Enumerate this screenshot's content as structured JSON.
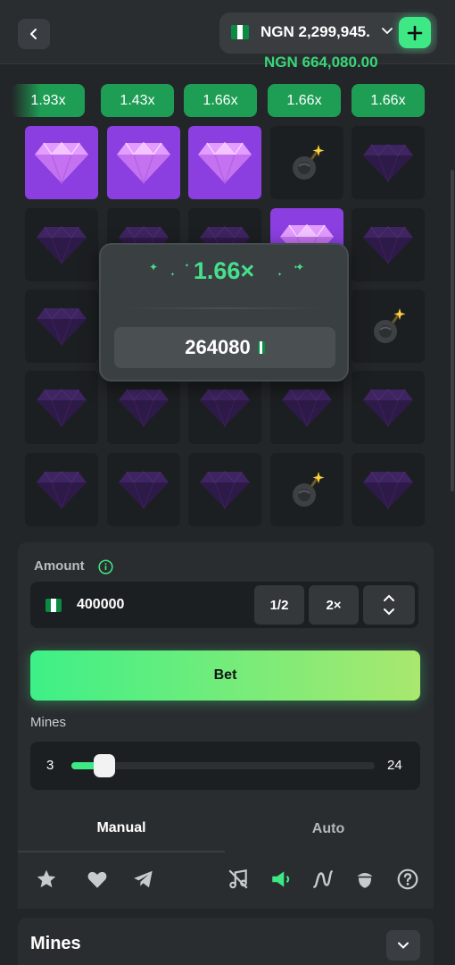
{
  "header": {
    "balance": "NGN 2,299,945.",
    "win_amount": "NGN 664,080.00"
  },
  "multipliers": [
    "1.93x",
    "1.43x",
    "1.66x",
    "1.66x",
    "1.66x"
  ],
  "grid": {
    "tiles": [
      [
        "gem-revealed",
        "gem-revealed",
        "gem-revealed",
        "bomb",
        "gem"
      ],
      [
        "gem",
        "gem",
        "gem",
        "gem-revealed",
        "gem"
      ],
      [
        "gem",
        "gem",
        "gem",
        "gem",
        "bomb"
      ],
      [
        "gem",
        "gem",
        "gem",
        "gem",
        "gem"
      ],
      [
        "gem",
        "gem",
        "gem",
        "bomb",
        "gem"
      ]
    ]
  },
  "result_popup": {
    "multiplier": "1.66×",
    "amount": "264080"
  },
  "controls": {
    "amount_label": "Amount",
    "amount_value": "400000",
    "half_label": "1/2",
    "double_label": "2×",
    "bet_label": "Bet",
    "mines_label": "Mines",
    "mines_min": "3",
    "mines_max": "24",
    "mines_level": 0.09
  },
  "tabs": [
    {
      "label": "Manual",
      "active": true
    },
    {
      "label": "Auto",
      "active": false
    }
  ],
  "toolbar_icons": [
    "star-icon",
    "heart-icon",
    "telegram-icon",
    "music-off-icon",
    "sound-icon",
    "graph-icon",
    "acorn-icon",
    "help-icon"
  ],
  "bottom_card": {
    "title": "Mines"
  },
  "colors": {
    "accent": "#3ee884",
    "gem_active_bg": "#8b3fe0",
    "chip": "#1e9e55",
    "background": "#232628"
  }
}
